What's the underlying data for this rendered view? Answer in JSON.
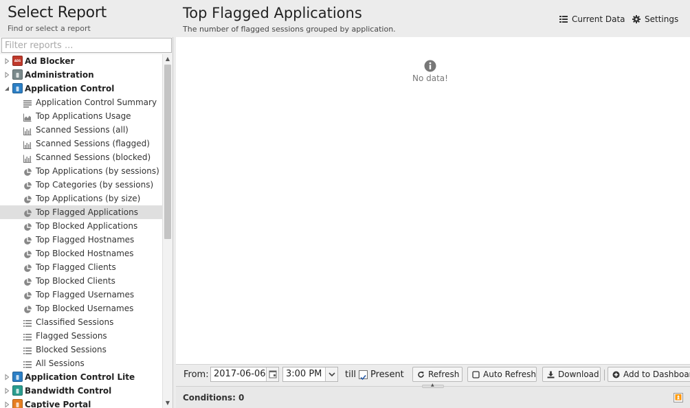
{
  "sidebar": {
    "title": "Select Report",
    "subtitle": "Find or select a report",
    "filter_placeholder": "Filter reports ...",
    "tree": [
      {
        "kind": "app",
        "label": "Ad Blocker",
        "expanded": false,
        "icon": "ad-blocker-icon",
        "color": "#c0392b",
        "badge": "ADS"
      },
      {
        "kind": "app",
        "label": "Administration",
        "expanded": false,
        "icon": "administration-icon",
        "color": "#7b8a8c"
      },
      {
        "kind": "app",
        "label": "Application Control",
        "expanded": true,
        "icon": "application-control-icon",
        "color": "#2c7fc5"
      },
      {
        "kind": "report",
        "label": "Application Control Summary",
        "icon": "text-lines-icon"
      },
      {
        "kind": "report",
        "label": "Top Applications Usage",
        "icon": "area-chart-icon"
      },
      {
        "kind": "report",
        "label": "Scanned Sessions (all)",
        "icon": "bar-chart-icon"
      },
      {
        "kind": "report",
        "label": "Scanned Sessions (flagged)",
        "icon": "bar-chart-icon"
      },
      {
        "kind": "report",
        "label": "Scanned Sessions (blocked)",
        "icon": "bar-chart-icon"
      },
      {
        "kind": "report",
        "label": "Top Applications (by sessions)",
        "icon": "pie-chart-icon"
      },
      {
        "kind": "report",
        "label": "Top Categories (by sessions)",
        "icon": "pie-chart-icon"
      },
      {
        "kind": "report",
        "label": "Top Applications (by size)",
        "icon": "pie-chart-icon"
      },
      {
        "kind": "report",
        "label": "Top Flagged Applications",
        "icon": "pie-chart-icon",
        "selected": true
      },
      {
        "kind": "report",
        "label": "Top Blocked Applications",
        "icon": "pie-chart-icon"
      },
      {
        "kind": "report",
        "label": "Top Flagged Hostnames",
        "icon": "pie-chart-icon"
      },
      {
        "kind": "report",
        "label": "Top Blocked Hostnames",
        "icon": "pie-chart-icon"
      },
      {
        "kind": "report",
        "label": "Top Flagged Clients",
        "icon": "pie-chart-icon"
      },
      {
        "kind": "report",
        "label": "Top Blocked Clients",
        "icon": "pie-chart-icon"
      },
      {
        "kind": "report",
        "label": "Top Flagged Usernames",
        "icon": "pie-chart-icon"
      },
      {
        "kind": "report",
        "label": "Top Blocked Usernames",
        "icon": "pie-chart-icon"
      },
      {
        "kind": "report",
        "label": "Classified Sessions",
        "icon": "list-icon"
      },
      {
        "kind": "report",
        "label": "Flagged Sessions",
        "icon": "list-icon"
      },
      {
        "kind": "report",
        "label": "Blocked Sessions",
        "icon": "list-icon"
      },
      {
        "kind": "report",
        "label": "All Sessions",
        "icon": "list-icon"
      },
      {
        "kind": "app",
        "label": "Application Control Lite",
        "expanded": false,
        "icon": "application-control-lite-icon",
        "color": "#2c7fc5"
      },
      {
        "kind": "app",
        "label": "Bandwidth Control",
        "expanded": false,
        "icon": "bandwidth-control-icon",
        "color": "#2a9d8f"
      },
      {
        "kind": "app",
        "label": "Captive Portal",
        "expanded": false,
        "icon": "captive-portal-icon",
        "color": "#e67e22"
      }
    ]
  },
  "report": {
    "title": "Top Flagged Applications",
    "description": "The number of flagged sessions grouped by application.",
    "current_data_label": "Current Data",
    "settings_label": "Settings",
    "no_data": "No data!"
  },
  "toolbar": {
    "from_label": "From:",
    "from_date": "2017-06-06",
    "from_time": "3:00 PM",
    "till_label": "till",
    "present_checked": true,
    "present_label": "Present",
    "refresh_label": "Refresh",
    "auto_refresh_label": "Auto Refresh",
    "download_label": "Download",
    "add_dashboard_label": "Add to Dashboar"
  },
  "conditions": {
    "label": "Conditions: 0"
  },
  "colors": {
    "accent": "#2c7fc5",
    "selected_row": "#dfdfdf",
    "panel_bg": "#ececec"
  }
}
